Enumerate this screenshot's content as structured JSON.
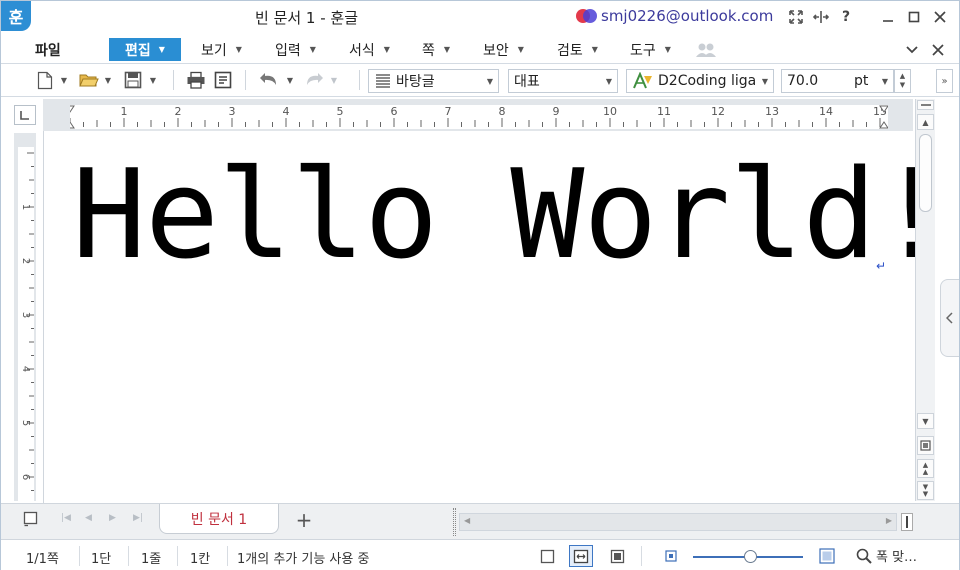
{
  "app": {
    "logo_char": "훈",
    "doc_title": "빈 문서 1 - 훈글",
    "account_email": "smj0226@outlook.com"
  },
  "menu": {
    "file": "파일",
    "items": [
      {
        "id": "edit",
        "label": "편집"
      },
      {
        "id": "view",
        "label": "보기"
      },
      {
        "id": "input",
        "label": "입력"
      },
      {
        "id": "format",
        "label": "서식"
      },
      {
        "id": "page",
        "label": "쪽"
      },
      {
        "id": "security",
        "label": "보안"
      },
      {
        "id": "review",
        "label": "검토"
      },
      {
        "id": "tools",
        "label": "도구"
      }
    ]
  },
  "toolbar": {
    "style_name": "바탕글",
    "font_category": "대표",
    "font_name": "D2Coding liga",
    "font_size": "70.0",
    "font_unit": "pt"
  },
  "rulers": {
    "h_numbers": [
      "1",
      "2",
      "3",
      "4",
      "5",
      "6",
      "7",
      "8",
      "9",
      "10",
      "11",
      "12",
      "13",
      "14",
      "15"
    ],
    "v_numbers": [
      "1",
      "2",
      "3",
      "4",
      "5",
      "6"
    ]
  },
  "document": {
    "text": "Hello World!",
    "enter_mark": "↵"
  },
  "tabs": {
    "doc_tab": "빈 문서 1",
    "add_tab": "+"
  },
  "status": {
    "page": "1/1쪽",
    "section": "1단",
    "line": "1줄",
    "column": "1칸",
    "addons": "1개의 추가 기능 사용 중",
    "zoom_label": "폭 맞…"
  },
  "colors": {
    "accent": "#2a8ed3",
    "account_text": "#3c3a9c",
    "tab_text": "#c0303e"
  },
  "zoom": {
    "level_fraction": 0.52
  }
}
